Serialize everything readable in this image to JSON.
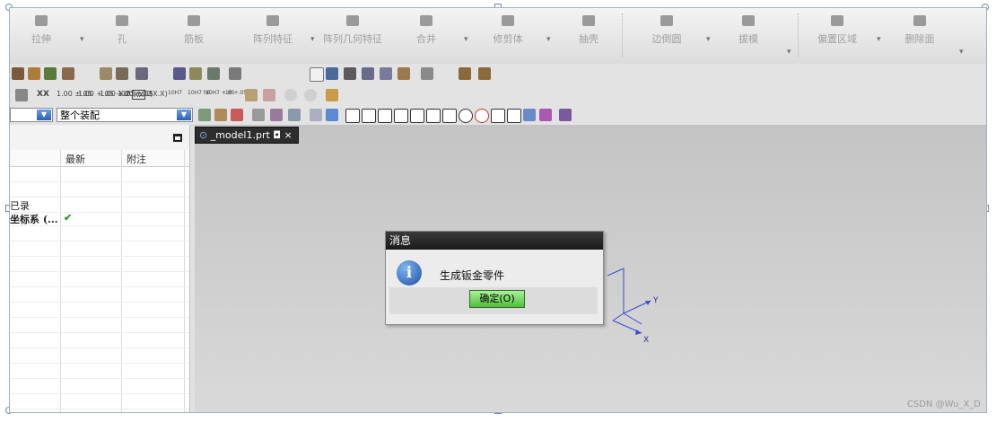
{
  "ribbon": {
    "items": [
      {
        "label": "拉伸",
        "icon": "extrude-icon"
      },
      {
        "label": "孔",
        "icon": "hole-icon"
      },
      {
        "label": "筋板",
        "icon": "rib-icon"
      },
      {
        "label": "阵列特征",
        "icon": "pattern-feature-icon"
      },
      {
        "label": "阵列几何特征",
        "icon": "pattern-geometry-icon"
      },
      {
        "label": "合并",
        "icon": "unite-icon"
      },
      {
        "label": "修剪体",
        "icon": "trim-body-icon"
      },
      {
        "label": "抽壳",
        "icon": "shell-icon"
      },
      {
        "label": "边倒圆",
        "icon": "edge-blend-icon"
      },
      {
        "label": "拔模",
        "icon": "draft-icon"
      },
      {
        "label": "偏置区域",
        "icon": "offset-region-icon"
      },
      {
        "label": "删除面",
        "icon": "delete-face-icon"
      }
    ],
    "dropdown_glyph": "▾"
  },
  "pmi_toolbar": {
    "items": [
      "XX",
      "1.00 ±.05",
      "1.00 +.05 -.02",
      "1.00 +.05 -.02",
      "1.00 ±.05",
      "XX",
      "(X.X)",
      "10H7",
      "10H7 h6",
      "10H7 +.05",
      ".10 +.05"
    ]
  },
  "filter_bar": {
    "selection_scope": "整个装配"
  },
  "navigator": {
    "columns": [
      "最新",
      "附注"
    ],
    "rows": [
      {
        "name": "",
        "latest": "",
        "note": ""
      },
      {
        "name": "",
        "latest": "",
        "note": ""
      },
      {
        "name": "已录",
        "latest": "",
        "note": ""
      },
      {
        "name": "坐标系 (...",
        "latest": "✔",
        "note": ""
      }
    ]
  },
  "graphics": {
    "tab_label": "_model1.prt",
    "tab_icons": "◘ ×",
    "axis_y": "Y",
    "axis_x": "X"
  },
  "dialog": {
    "title": "消息",
    "icon": "info-icon",
    "message": "生成钣金零件",
    "ok_label": "确定(O)"
  },
  "watermark": "CSDN @Wu_X_D",
  "colors": {
    "dialog_title_bg": "#1f1f1f",
    "ok_button": "#5fcf4a",
    "checkmark": "#2a9a2a"
  }
}
